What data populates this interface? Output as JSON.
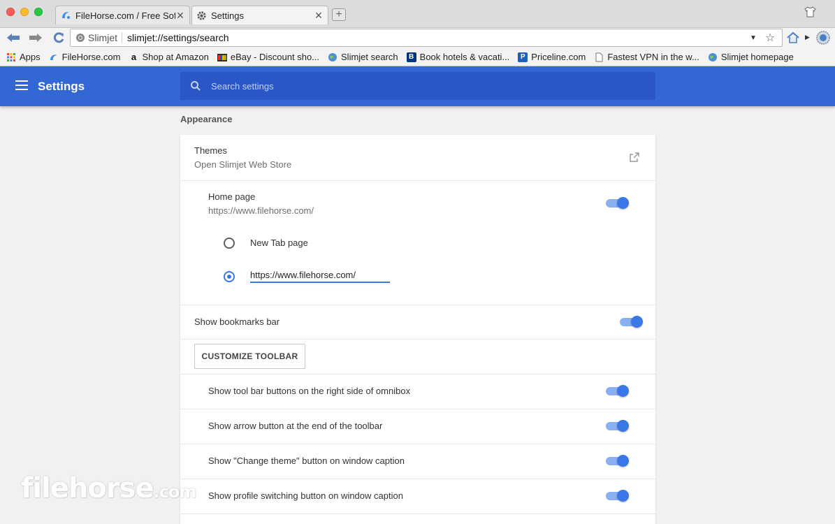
{
  "tabs": [
    {
      "title": "FileHorse.com / Free Sof",
      "icon": "filehorse-icon"
    },
    {
      "title": "Settings",
      "icon": "gear-icon"
    }
  ],
  "toolbar": {
    "brand": "Slimjet",
    "url": "slimjet://settings/search"
  },
  "bookmarks": [
    {
      "label": "Apps",
      "icon": "apps-grid-icon"
    },
    {
      "label": "FileHorse.com",
      "icon": "filehorse-icon"
    },
    {
      "label": "Shop at Amazon",
      "icon": "amazon-icon"
    },
    {
      "label": "eBay - Discount sho...",
      "icon": "ebay-icon"
    },
    {
      "label": "Slimjet search",
      "icon": "globe-icon"
    },
    {
      "label": "Book hotels & vacati...",
      "icon": "booking-icon"
    },
    {
      "label": "Priceline.com",
      "icon": "priceline-icon"
    },
    {
      "label": "Fastest VPN in the w...",
      "icon": "page-icon"
    },
    {
      "label": "Slimjet homepage",
      "icon": "globe-icon"
    }
  ],
  "header": {
    "title": "Settings",
    "search_placeholder": "Search settings"
  },
  "appearance": {
    "section_title": "Appearance",
    "themes_title": "Themes",
    "themes_sub": "Open Slimjet Web Store",
    "home_page_title": "Home page",
    "home_page_url": "https://www.filehorse.com/",
    "home_page_enabled": true,
    "radio_new_tab": "New Tab page",
    "radio_url_value": "https://www.filehorse.com/",
    "selected_option": "custom-url",
    "bookmarks_bar_label": "Show bookmarks bar",
    "bookmarks_bar_enabled": true,
    "customize_button": "CUSTOMIZE TOOLBAR",
    "toggles": [
      {
        "label": "Show tool bar buttons on the right side of omnibox",
        "enabled": true
      },
      {
        "label": "Show arrow button at the end of the toolbar",
        "enabled": true
      },
      {
        "label": "Show \"Change theme\" button on window caption",
        "enabled": true
      },
      {
        "label": "Show profile switching button on window caption",
        "enabled": true
      }
    ]
  },
  "colors": {
    "accent": "#3367d6",
    "toggle_on": "#3b78e7"
  },
  "watermark": {
    "main": "filehorse",
    "suffix": ".com"
  }
}
